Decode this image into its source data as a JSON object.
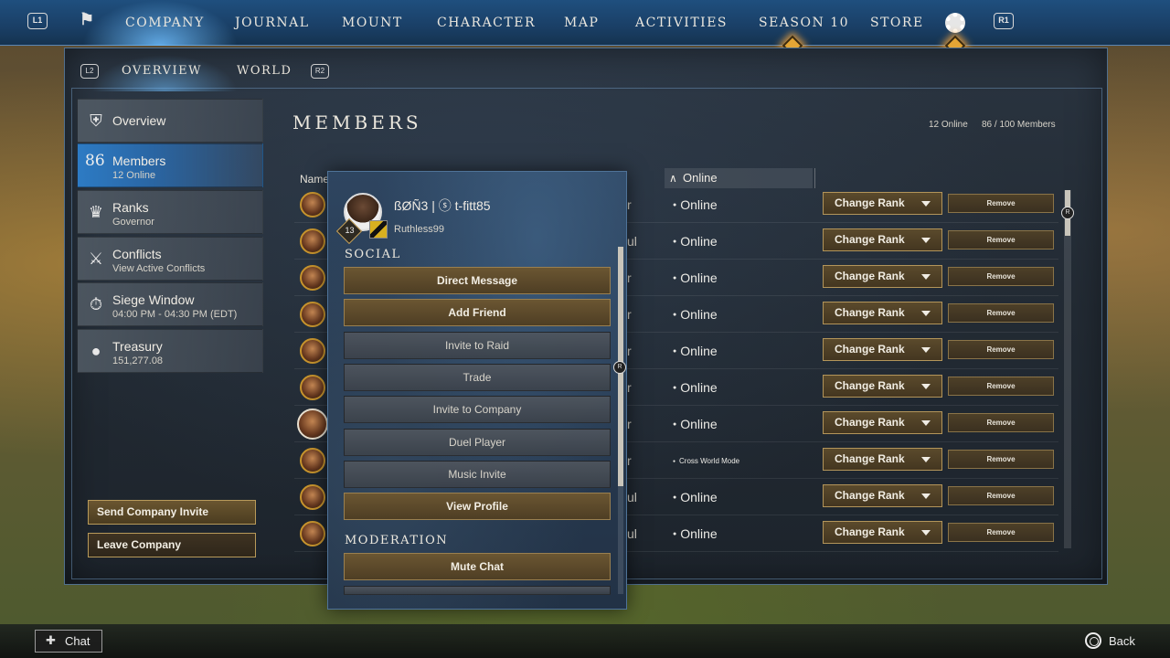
{
  "nav": {
    "left_badge": "L1",
    "right_badge": "R1",
    "items": [
      "COMPANY",
      "JOURNAL",
      "MOUNT",
      "CHARACTER",
      "MAP",
      "ACTIVITIES",
      "SEASON 10",
      "STORE"
    ]
  },
  "subnav": {
    "left_badge": "L2",
    "right_badge": "R2",
    "items": [
      "OVERVIEW",
      "WORLD"
    ]
  },
  "sidebar": {
    "items": [
      {
        "title": "Overview",
        "sub": ""
      },
      {
        "title": "Members",
        "sub": "12 Online",
        "num": "86"
      },
      {
        "title": "Ranks",
        "sub": "Governor"
      },
      {
        "title": "Conflicts",
        "sub": "View Active Conflicts"
      },
      {
        "title": "Siege Window",
        "sub": "04:00 PM - 04:30 PM  (EDT)"
      },
      {
        "title": "Treasury",
        "sub": "151,277.08"
      }
    ],
    "send_invite": "Send Company Invite",
    "leave": "Leave Company"
  },
  "members": {
    "title": "MEMBERS",
    "online_count": "12 Online",
    "member_count": "86 / 100 Members",
    "col_name": "Name",
    "col_online": "Online",
    "change_rank_label": "Change Rank",
    "remove_label": "Remove",
    "rows": [
      {
        "rank": "r",
        "status": "Online"
      },
      {
        "rank": "ul",
        "status": "Online"
      },
      {
        "rank": "r",
        "status": "Online"
      },
      {
        "rank": "r",
        "status": "Online"
      },
      {
        "rank": "r",
        "status": "Online"
      },
      {
        "rank": "r",
        "status": "Online"
      },
      {
        "rank": "r",
        "status": "Online"
      },
      {
        "rank": "r",
        "status": "Cross World Mode"
      },
      {
        "rank": "ul",
        "status": "Online"
      },
      {
        "rank": "ul",
        "status": "Online"
      }
    ]
  },
  "popup": {
    "player_name": "ßØÑ3 | ⓢ t-fitt85",
    "player_sub": "Ruthless99",
    "level": "13",
    "social_header": "SOCIAL",
    "moderation_header": "MODERATION",
    "buttons": [
      "Direct Message",
      "Add Friend",
      "Invite to Raid",
      "Trade",
      "Invite to Company",
      "Duel Player",
      "Music Invite",
      "View Profile"
    ],
    "mod_buttons": [
      "Mute Chat"
    ]
  },
  "bottom": {
    "chat": "Chat",
    "back": "Back"
  },
  "colors": {
    "nav_blue": "#1f4f7e",
    "gold": "#b89a5a",
    "accent_diamond": "#e3a535"
  }
}
